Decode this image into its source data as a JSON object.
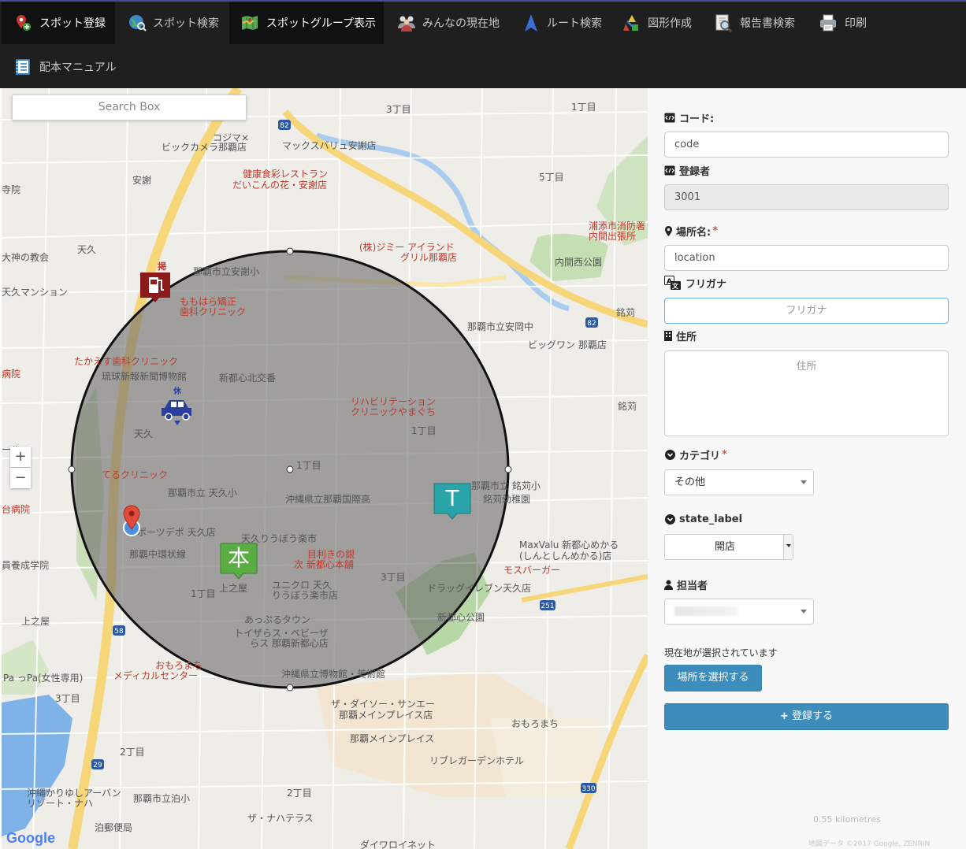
{
  "nav": {
    "items": [
      {
        "label": "スポット登録",
        "icon": "map-pin-add-icon",
        "active": true
      },
      {
        "label": "スポット検索",
        "icon": "globe-search-icon",
        "active": false
      },
      {
        "label": "スポットグループ表示",
        "icon": "folded-map-icon",
        "active": true
      },
      {
        "label": "みんなの現在地",
        "icon": "people-group-icon",
        "active": false
      },
      {
        "label": "ルート検索",
        "icon": "navigation-arrow-icon",
        "active": false
      },
      {
        "label": "図形作成",
        "icon": "shapes-icon",
        "active": false
      },
      {
        "label": "報告書検索",
        "icon": "report-search-icon",
        "active": false
      },
      {
        "label": "印刷",
        "icon": "printer-icon",
        "active": false
      },
      {
        "label": "配本マニュアル",
        "icon": "manual-book-icon",
        "active": false
      }
    ]
  },
  "map": {
    "search_placeholder": "Search Box",
    "zoom_in": "+",
    "zoom_out": "−",
    "google": "Google",
    "attribution": "地図データ ©2017 Google, ZENRIN",
    "scale": "0.55 kilometres",
    "markers": {
      "fuel": "fuel-station-icon",
      "taxi": "taxi-icon",
      "book": "本",
      "t": "T",
      "location": "location-pin-icon",
      "taxi_badge": "休",
      "fuel_badge": "掲"
    },
    "labels": [
      "3丁目",
      "1丁目",
      "コジマ×",
      "ビックカメラ那覇店",
      "マックスバリュ安謝店",
      "健康食彩レストラン",
      "だいこんの花・安謝店",
      "安謝",
      "5丁目",
      "浦添市消防署",
      "内間出張所",
      "(株)ジミー アイランド",
      "グリル那覇店",
      "内間西公園",
      "天久",
      "大神の教会",
      "天久マンション",
      "那覇市立安謝小",
      "ももはら矯正",
      "歯科クリニック",
      "銘苅",
      "那覇市立安岡中",
      "ビッグワン 那覇店",
      "たかえす歯科クリニック",
      "琉球新報新聞博物館",
      "新都心北交番",
      "リハビリテーション",
      "クリニックやまぐち",
      "1丁目",
      "銘苅",
      "天久",
      "てるクリニック",
      "1丁目",
      "那覇市立 天久小",
      "沖縄県立那覇国際高",
      "那覇市立 銘苅小",
      "銘苅幼稚園",
      "ポーツデポ 天久店",
      "天久りうぼう楽市",
      "那覇中環状線",
      "目利きの銀",
      "次 新都心本舗",
      "MaxValu 新都心めかる",
      "(しんとしんめかる)店",
      "モスバーガー",
      "上之屋",
      "1丁目",
      "ユニクロ 天久",
      "りうぼう楽市店",
      "3丁目",
      "ドラッグイレブン天久店",
      "新都心公園",
      "あっぷるタウン",
      "トイザらス・ベビーザ",
      "らス 那覇新都心店",
      "上之屋",
      "おもろまち",
      "メディカルセンター",
      "沖縄県立博物館・美術館",
      "Pa っPa(女性専用)",
      "3丁目",
      "ザ・ダイソー・サンエー",
      "那覇メインプレイス店",
      "おもろまち",
      "那覇メインプレイス",
      "リブレガーデンホテル",
      "2丁目",
      "沖縄かりゆしアーバン",
      "リゾート・ナハ",
      "那覇市立泊小",
      "2丁目",
      "泊郵便局",
      "ザ・ナハテラス",
      "ダイワロイネット",
      "寺院",
      "ール",
      "台病院",
      "員養成学院",
      "病院"
    ]
  },
  "form": {
    "code_label": "コード:",
    "code_value": "code",
    "registrant_label": "登録者",
    "registrant_value": "3001",
    "place_label": "場所名:",
    "place_value": "location",
    "furigana_label": "フリガナ",
    "furigana_placeholder": "フリガナ",
    "address_label": "住所",
    "address_placeholder": "住所",
    "category_label": "カテゴリ",
    "category_value": "その他",
    "state_label": "state_label",
    "state_value": "開店",
    "person_label": "担当者",
    "person_value": "",
    "location_status": "現在地が選択されています",
    "select_place_button": "場所を選択する",
    "register_button": "登録する",
    "required_mark": "*"
  },
  "colors": {
    "nav_bg": "#1f1f1f",
    "accent": "#3c8dbc",
    "circle_fill": "#6b6b6b",
    "book_marker": "#5aac44",
    "t_marker": "#29a4a8",
    "fuel_marker": "#8b1a1a"
  }
}
